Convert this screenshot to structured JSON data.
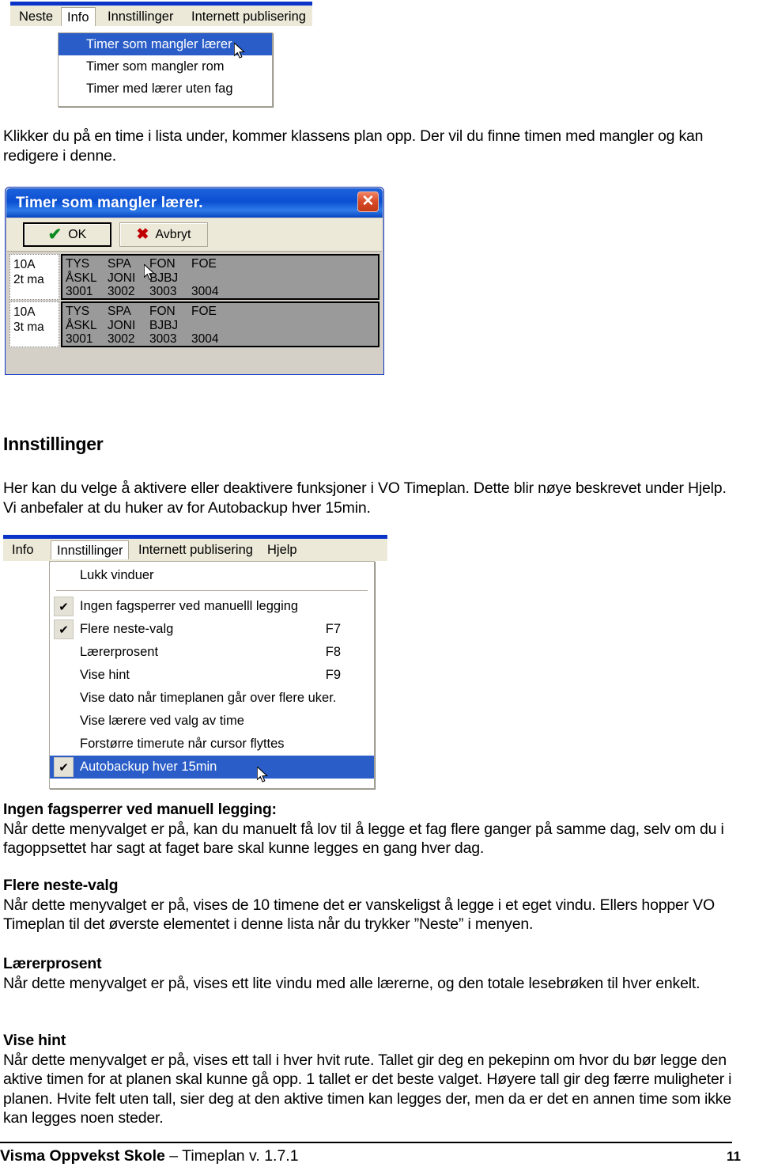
{
  "document": {
    "footer": {
      "title_bold": "Visma Oppvekst Skole",
      "title_rest": " – Timeplan v. 1.7.1",
      "page_number": "11"
    }
  },
  "screenshot_info_menu": {
    "menubar": [
      {
        "label": "Neste",
        "active": false
      },
      {
        "label": "Info",
        "active": true
      },
      {
        "label": "Innstillinger",
        "active": false
      },
      {
        "label": "Internett publisering",
        "active": false
      }
    ],
    "dropdown": [
      {
        "label": "Timer som mangler lærer",
        "selected": true
      },
      {
        "label": "Timer som mangler rom",
        "selected": false
      },
      {
        "label": "Timer med lærer uten fag",
        "selected": false
      }
    ]
  },
  "paragraph_1": "Klikker du på en time i lista under, kommer klassens plan opp. Der vil du finne timen med mangler og kan redigere i denne.",
  "dialog": {
    "title": "Timer som mangler lærer.",
    "close_label": "✕",
    "buttons": [
      {
        "label": "OK",
        "icon": "check-icon"
      },
      {
        "label": "Avbryt",
        "icon": "cross-icon"
      }
    ],
    "rows": [
      {
        "class": "10A",
        "duration": "2t ma",
        "subjects": [
          "TYS",
          "SPA",
          "FON",
          "FOE"
        ],
        "teachers": [
          "ÅSKL",
          "JONI",
          "BJBJ",
          ""
        ],
        "codes": [
          "3001",
          "3002",
          "3003",
          "3004"
        ]
      },
      {
        "class": "10A",
        "duration": "3t ma",
        "subjects": [
          "TYS",
          "SPA",
          "FON",
          "FOE"
        ],
        "teachers": [
          "ÅSKL",
          "JONI",
          "BJBJ",
          ""
        ],
        "codes": [
          "3001",
          "3002",
          "3003",
          "3004"
        ]
      }
    ]
  },
  "section_innstillinger": {
    "heading": "Innstillinger",
    "paragraph": "Her kan du velge å aktivere eller deaktivere funksjoner i VO Timeplan. Dette blir nøye beskrevet under Hjelp. Vi anbefaler at du huker av for Autobackup hver 15min."
  },
  "screenshot_settings_menu": {
    "menubar": [
      {
        "label": "Info",
        "active": false
      },
      {
        "label": "Innstillinger",
        "active": true
      },
      {
        "label": "Internett publisering",
        "active": false
      },
      {
        "label": "Hjelp",
        "active": false
      }
    ],
    "items": [
      {
        "label": "Lukk vinduer",
        "accel": "",
        "checked": false,
        "selected": false
      },
      {
        "separator": true
      },
      {
        "label": "Ingen fagsperrer ved manuelll legging",
        "accel": "",
        "checked": true,
        "selected": false
      },
      {
        "label": "Flere neste-valg",
        "accel": "F7",
        "checked": true,
        "selected": false
      },
      {
        "label": "Lærerprosent",
        "accel": "F8",
        "checked": false,
        "selected": false
      },
      {
        "label": "Vise hint",
        "accel": "F9",
        "checked": false,
        "selected": false
      },
      {
        "label": "Vise dato når timeplanen går over flere uker.",
        "accel": "",
        "checked": false,
        "selected": false
      },
      {
        "label": "Vise lærere ved valg av time",
        "accel": "",
        "checked": false,
        "selected": false
      },
      {
        "label": "Forstørre timerute når cursor flyttes",
        "accel": "",
        "checked": false,
        "selected": false
      },
      {
        "label": "Autobackup  hver 15min",
        "accel": "",
        "checked": true,
        "selected": true
      }
    ],
    "check_glyph": "✔"
  },
  "sections": [
    {
      "heading": "Ingen fagsperrer ved manuell legging:",
      "body": "Når dette menyvalget er på, kan du manuelt få lov til å legge et fag flere ganger på samme dag, selv om du i fagoppsettet har sagt at faget bare skal kunne legges en gang hver dag."
    },
    {
      "heading": "Flere neste-valg",
      "body": "Når dette menyvalget er på, vises de 10 timene det er vanskeligst å legge i et eget vindu. Ellers hopper VO Timeplan til det øverste elementet i denne lista når du trykker ”Neste” i menyen."
    },
    {
      "heading": "Lærerprosent",
      "body": "Når dette menyvalget er på, vises ett lite vindu med alle lærerne, og den totale lesebrøken til hver enkelt."
    },
    {
      "heading": "Vise hint",
      "body": "Når dette menyvalget er på, vises ett tall i hver hvit rute. Tallet gir deg en pekepinn om hvor du bør legge den aktive timen for at planen skal kunne gå opp. 1 tallet er det beste valget. Høyere tall gir deg færre muligheter i planen. Hvite felt uten tall, sier deg at den aktive timen kan legges der, men da er det en annen time som ikke kan legges noen steder."
    }
  ],
  "colors": {
    "menu_bar_bg": "#ECE9D8",
    "menu_highlight": "#2A5DC8",
    "dialog_titlebar": "#0B4FD2",
    "grid_cell_bg": "#9A9A9A",
    "close_button": "#D64A27"
  }
}
